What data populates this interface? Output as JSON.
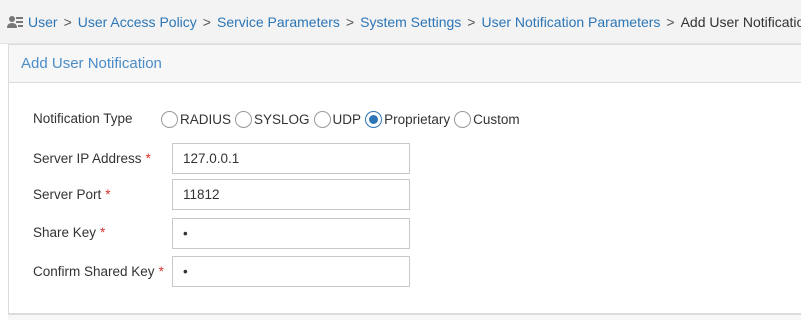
{
  "breadcrumb": {
    "items": [
      "User",
      "User Access Policy",
      "Service Parameters",
      "System Settings",
      "User Notification Parameters"
    ],
    "separator": ">",
    "current": "Add User Notification"
  },
  "panel": {
    "title": "Add User Notification"
  },
  "form": {
    "notification_type": {
      "label": "Notification Type",
      "options": [
        "RADIUS",
        "SYSLOG",
        "UDP",
        "Proprietary",
        "Custom"
      ],
      "selected": "Proprietary"
    },
    "server_ip": {
      "label": "Server IP Address",
      "required_mark": "*",
      "value": "127.0.0.1"
    },
    "server_port": {
      "label": "Server Port",
      "required_mark": "*",
      "value": "11812"
    },
    "share_key": {
      "label": "Share Key",
      "required_mark": "*",
      "value": "•"
    },
    "confirm_key": {
      "label": "Confirm Shared Key",
      "required_mark": "*",
      "value": "•"
    }
  },
  "colors": {
    "link": "#2c76b7",
    "panel_title": "#4a8cc7",
    "required": "#d9312b"
  }
}
